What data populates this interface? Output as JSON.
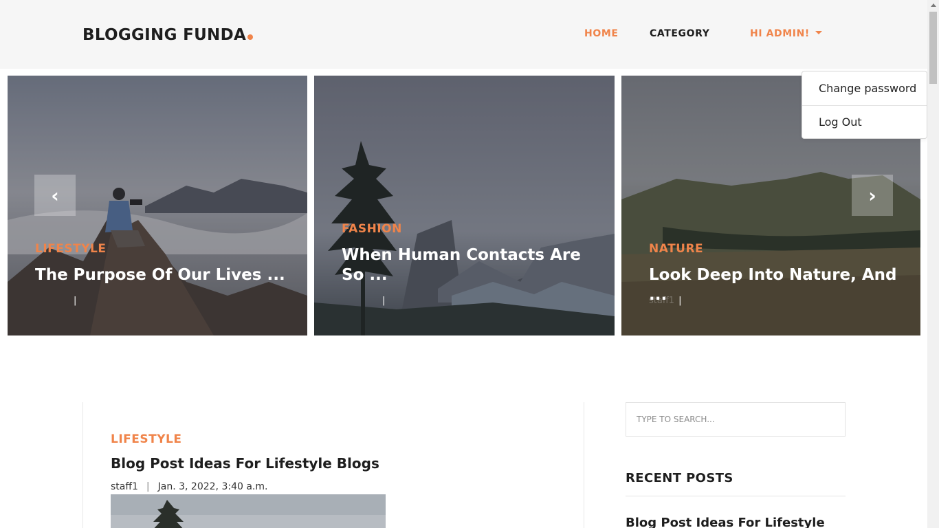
{
  "header": {
    "logo": "BLOGGING FUNDA",
    "nav": {
      "home": "HOME",
      "category": "CATEGORY",
      "admin": "HI ADMIN!"
    }
  },
  "dropdown": {
    "items": [
      "Change password",
      "Log Out"
    ]
  },
  "slider": {
    "slides": [
      {
        "category": "LIFESTYLE",
        "title": "The Purpose Of Our Lives ...",
        "author": "",
        "separator": "|"
      },
      {
        "category": "FASHION",
        "title": "When Human Contacts Are So ...",
        "author": "",
        "separator": "|"
      },
      {
        "category": "NATURE",
        "title": "Look Deep Into Nature, And ...",
        "author": "staff1",
        "separator": "|"
      }
    ],
    "prev_icon": "‹",
    "next_icon": "›"
  },
  "post": {
    "category": "LIFESTYLE",
    "title": "Blog Post Ideas For Lifestyle Blogs",
    "author": "staff1",
    "separator": "|",
    "date": "Jan. 3, 2022, 3:40 a.m."
  },
  "sidebar": {
    "search_placeholder": "TYPE TO SEARCH...",
    "recent_heading": "RECENT POSTS",
    "recent_posts": [
      "Blog Post Ideas For Lifestyle"
    ]
  },
  "colors": {
    "accent": "#f0844a",
    "header_bg": "#f6f6f6",
    "text": "#1e1e1e"
  }
}
